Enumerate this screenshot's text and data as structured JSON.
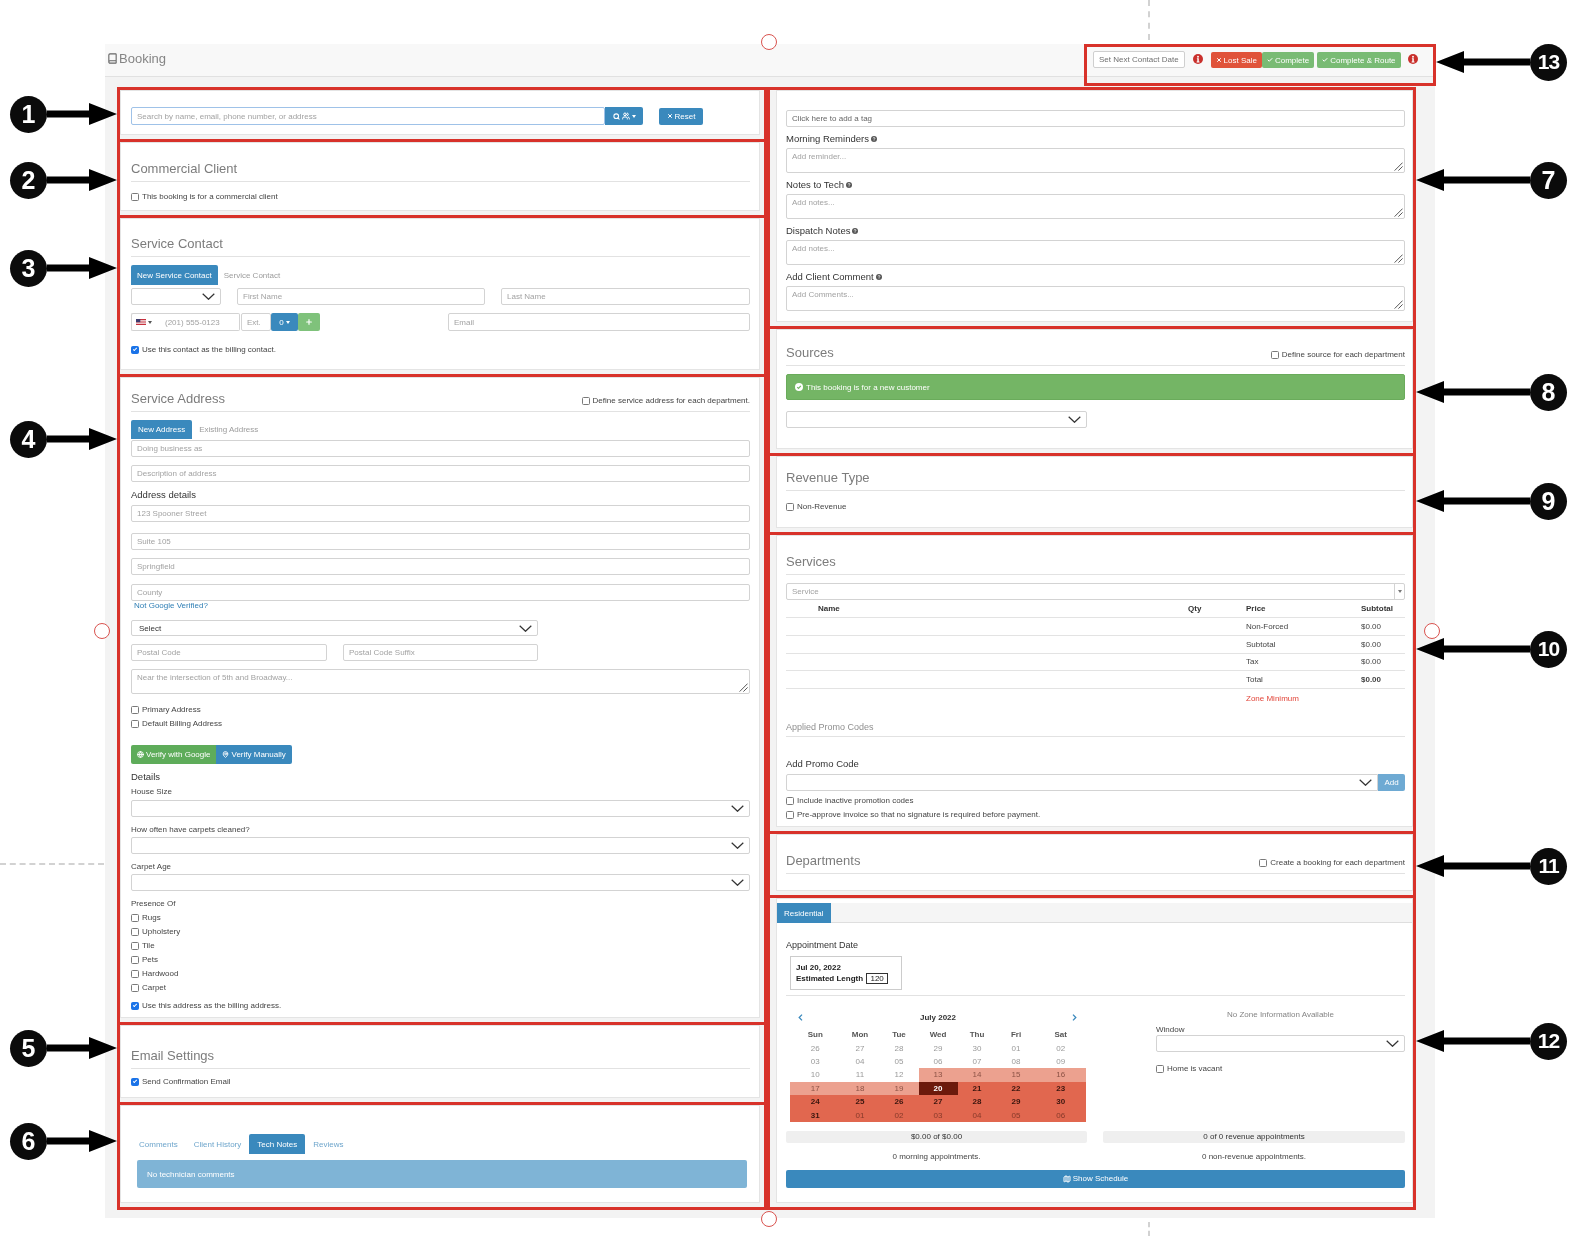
{
  "header": {
    "title": "Booking",
    "contact_button": "Set Next Contact Date",
    "actions": [
      {
        "kind": "danger",
        "label": "Lost Sale"
      },
      {
        "kind": "success",
        "label": "Complete"
      },
      {
        "kind": "success",
        "label": "Complete & Route"
      }
    ],
    "callout": "13"
  },
  "search": {
    "callout": "1",
    "placeholder": "Search by name, email, phone number, or address",
    "reset_button": "Reset"
  },
  "commercial_client": {
    "callout": "2",
    "title": "Commercial Client",
    "checkbox": {
      "label": "This booking is for a commercial client",
      "checked": false
    }
  },
  "service_contact": {
    "callout": "3",
    "title": "Service Contact",
    "tabs": [
      {
        "label": "New Service Contact",
        "selected": true
      },
      {
        "label": "Service Contact",
        "selected": false
      }
    ],
    "first_name": {
      "placeholder": "First Name"
    },
    "last_name": {
      "placeholder": "Last Name"
    },
    "phone": {
      "placeholder": "(201) 555-0123"
    },
    "extension": {
      "placeholder": "Ext."
    },
    "phone_type": "0",
    "email": {
      "placeholder": "Email"
    },
    "billing_checkbox": {
      "label": "Use this contact as the billing contact.",
      "checked": true
    }
  },
  "service_address": {
    "callout": "4",
    "title": "Service Address",
    "department_checkbox": {
      "label": "Define service address for each department.",
      "checked": false
    },
    "tabs": [
      {
        "label": "New Address",
        "selected": true
      },
      {
        "label": "Existing Address",
        "selected": false
      }
    ],
    "business_name": {
      "placeholder": "Doing business as"
    },
    "description": {
      "placeholder": "Description of address"
    },
    "details_label": "Address details",
    "street": {
      "placeholder": "123 Spooner Street"
    },
    "unit": {
      "placeholder": "Suite 105"
    },
    "city": {
      "placeholder": "Springfield"
    },
    "county": {
      "placeholder": "County"
    },
    "verify_link": "Not Google Verified?",
    "state_select": {
      "value": "Select"
    },
    "postal_code": {
      "placeholder": "Postal Code"
    },
    "postal_suffix": {
      "placeholder": "Postal Code Suffix"
    },
    "directions": {
      "placeholder": "Near the intersection of 5th and Broadway..."
    },
    "address_checkboxes": [
      {
        "label": "Primary Address",
        "checked": false
      },
      {
        "label": "Default Billing Address",
        "checked": false
      }
    ],
    "verify_buttons": [
      {
        "kind": "google",
        "label": "Verify with Google"
      },
      {
        "kind": "manual",
        "label": "Verify Manually"
      }
    ],
    "details_title": "Details",
    "detail_selects": [
      {
        "label": "House Size"
      },
      {
        "label": "How often have carpets cleaned?"
      },
      {
        "label": "Carpet Age"
      }
    ],
    "presence_label": "Presence Of",
    "presence": [
      {
        "label": "Rugs",
        "checked": false
      },
      {
        "label": "Upholstery",
        "checked": false
      },
      {
        "label": "Tile",
        "checked": false
      },
      {
        "label": "Pets",
        "checked": false
      },
      {
        "label": "Hardwood",
        "checked": false
      },
      {
        "label": "Carpet",
        "checked": false
      }
    ],
    "billing_checkbox": {
      "label": "Use this address as the billing address.",
      "checked": true
    }
  },
  "email_settings": {
    "callout": "5",
    "title": "Email Settings",
    "checkbox": {
      "label": "Send Confirmation Email",
      "checked": true
    }
  },
  "history": {
    "callout": "6",
    "tabs": [
      {
        "label": "Comments",
        "selected": false
      },
      {
        "label": "Client History",
        "selected": false
      },
      {
        "label": "Tech Notes",
        "selected": true
      },
      {
        "label": "Reviews",
        "selected": false
      }
    ],
    "message": "No technician comments"
  },
  "notes": {
    "callout": "7",
    "tag_field": {
      "placeholder": "Click here to add a tag"
    },
    "fields": [
      {
        "label": "Morning Reminders",
        "placeholder": "Add reminder..."
      },
      {
        "label": "Notes to Tech",
        "placeholder": "Add notes..."
      },
      {
        "label": "Dispatch Notes",
        "placeholder": "Add notes..."
      },
      {
        "label": "Add Client Comment",
        "placeholder": "Add Comments..."
      }
    ]
  },
  "sources": {
    "callout": "8",
    "title": "Sources",
    "department_checkbox": {
      "label": "Define source for each department",
      "checked": false
    },
    "status": "This booking is for a new customer"
  },
  "revenue_type": {
    "callout": "9",
    "title": "Revenue Type",
    "checkbox": {
      "label": "Non-Revenue",
      "checked": false
    }
  },
  "services": {
    "callout": "10",
    "title": "Services",
    "service_field": {
      "placeholder": "Service"
    },
    "table": {
      "columns": [
        "Name",
        "Qty",
        "Price",
        "Subtotal"
      ],
      "rows": [
        {
          "label": "Non-Forced",
          "amount": "$0.00",
          "bold": false
        },
        {
          "label": "Subtotal",
          "amount": "$0.00",
          "bold": false
        },
        {
          "label": "Tax",
          "amount": "$0.00",
          "bold": false
        },
        {
          "label": "Total",
          "amount": "$0.00",
          "bold": true
        }
      ]
    },
    "zone_minimum": "Zone Minimum",
    "promo_title": "Applied Promo Codes",
    "promo_label": "Add Promo Code",
    "add_button": "Add",
    "checkboxes": [
      {
        "label": "Include inactive promotion codes",
        "checked": false
      },
      {
        "label": "Pre-approve invoice so that no signature is required before payment.",
        "checked": false
      }
    ]
  },
  "departments": {
    "callout": "11",
    "title": "Departments",
    "checkbox": {
      "label": "Create a booking for each department",
      "checked": false
    }
  },
  "appointment": {
    "callout": "12",
    "tabs": [
      {
        "label": "Residential",
        "selected": true
      }
    ],
    "date_label": "Appointment Date",
    "date": "Jul 20, 2022",
    "length_label": "Estimated Length",
    "length": "120",
    "calendar": {
      "month": "July 2022",
      "weekdays": [
        "Sun",
        "Mon",
        "Tue",
        "Wed",
        "Thu",
        "Fri",
        "Sat"
      ],
      "weeks": [
        [
          {
            "label": "26",
            "muted": true,
            "selected": false
          },
          {
            "label": "27",
            "muted": true,
            "selected": false
          },
          {
            "label": "28",
            "muted": true,
            "selected": false
          },
          {
            "label": "29",
            "muted": true,
            "selected": false
          },
          {
            "label": "30",
            "muted": true,
            "selected": false
          },
          {
            "label": "01",
            "muted": true,
            "selected": false
          },
          {
            "label": "02",
            "muted": true,
            "selected": false
          }
        ],
        [
          {
            "label": "03",
            "muted": true,
            "selected": false
          },
          {
            "label": "04",
            "muted": true,
            "selected": false
          },
          {
            "label": "05",
            "muted": true,
            "selected": false
          },
          {
            "label": "06",
            "muted": true,
            "selected": false
          },
          {
            "label": "07",
            "muted": true,
            "selected": false
          },
          {
            "label": "08",
            "muted": true,
            "selected": false
          },
          {
            "label": "09",
            "muted": true,
            "selected": false
          }
        ],
        [
          {
            "label": "10",
            "muted": true,
            "selected": false
          },
          {
            "label": "11",
            "muted": true,
            "selected": false
          },
          {
            "label": "12",
            "muted": true,
            "selected": false
          },
          {
            "label": "13",
            "muted": true,
            "selected": false,
            "color": "#eca18f"
          },
          {
            "label": "14",
            "muted": true,
            "selected": false,
            "color": "#eca18f"
          },
          {
            "label": "15",
            "muted": true,
            "selected": false,
            "color": "#eca18f"
          },
          {
            "label": "16",
            "muted": true,
            "selected": false,
            "color": "#eca18f"
          }
        ],
        [
          {
            "label": "17",
            "muted": true,
            "selected": false,
            "color": "#eca18f"
          },
          {
            "label": "18",
            "muted": true,
            "selected": false,
            "color": "#eca18f"
          },
          {
            "label": "19",
            "muted": true,
            "selected": false,
            "color": "#eca18f"
          },
          {
            "label": "20",
            "muted": false,
            "selected": true,
            "color": "#6c1a0c"
          },
          {
            "label": "21",
            "muted": false,
            "selected": false,
            "color": "#e1674f"
          },
          {
            "label": "22",
            "muted": false,
            "selected": false,
            "color": "#e1674f"
          },
          {
            "label": "23",
            "muted": false,
            "selected": false,
            "color": "#e1674f"
          }
        ],
        [
          {
            "label": "24",
            "muted": false,
            "selected": false,
            "color": "#e1674f"
          },
          {
            "label": "25",
            "muted": false,
            "selected": false,
            "color": "#e1674f"
          },
          {
            "label": "26",
            "muted": false,
            "selected": false,
            "color": "#e1674f"
          },
          {
            "label": "27",
            "muted": false,
            "selected": false,
            "color": "#e1674f"
          },
          {
            "label": "28",
            "muted": false,
            "selected": false,
            "color": "#e1674f"
          },
          {
            "label": "29",
            "muted": false,
            "selected": false,
            "color": "#e1674f"
          },
          {
            "label": "30",
            "muted": false,
            "selected": false,
            "color": "#e1674f"
          }
        ],
        [
          {
            "label": "31",
            "muted": false,
            "selected": false,
            "color": "#e1674f"
          },
          {
            "label": "01",
            "muted": true,
            "selected": false,
            "color": "#e1674f"
          },
          {
            "label": "02",
            "muted": true,
            "selected": false,
            "color": "#e1674f"
          },
          {
            "label": "03",
            "muted": true,
            "selected": false,
            "color": "#e1674f"
          },
          {
            "label": "04",
            "muted": true,
            "selected": false,
            "color": "#e1674f"
          },
          {
            "label": "05",
            "muted": true,
            "selected": false,
            "color": "#e1674f"
          },
          {
            "label": "06",
            "muted": true,
            "selected": false,
            "color": "#e1674f"
          }
        ]
      ]
    },
    "zone_info": "No Zone Information Available",
    "window_label": "Window",
    "vacant_checkbox": {
      "label": "Home is vacant",
      "checked": false
    },
    "totals": [
      "$0.00 of $0.00",
      "0 of 0 revenue appointments"
    ],
    "counts": [
      "0 morning appointments.",
      "0 non-revenue appointments."
    ],
    "schedule_button": "Show Schedule"
  }
}
